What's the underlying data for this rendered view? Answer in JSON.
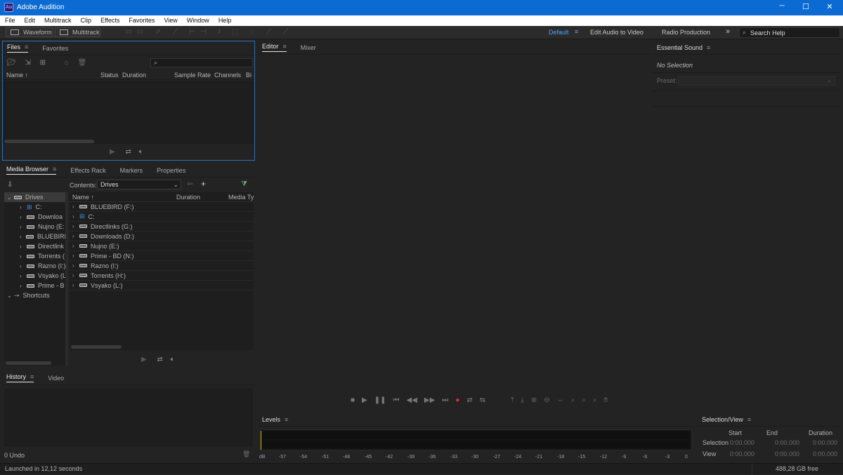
{
  "app": {
    "title": "Adobe Audition",
    "logo": "Au",
    "accent": "#0b6bd3"
  },
  "window_controls": {
    "minimize": "─",
    "maximize": "☐",
    "close": "✕"
  },
  "menu": [
    "File",
    "Edit",
    "Multitrack",
    "Clip",
    "Effects",
    "Favorites",
    "View",
    "Window",
    "Help"
  ],
  "toolbar": {
    "waveform_label": "Waveform",
    "multitrack_label": "Multitrack",
    "workspaces": [
      "Default",
      "Edit Audio to Video",
      "Radio Production"
    ],
    "active_workspace": "Default",
    "more": "»",
    "search_placeholder": "Search Help"
  },
  "files_panel": {
    "tabs": [
      "Files",
      "Favorites"
    ],
    "columns": [
      "Name",
      "Status",
      "Duration",
      "Sample Rate",
      "Channels",
      "Bi"
    ]
  },
  "media_browser": {
    "tabs": [
      "Media Browser",
      "Effects Rack",
      "Markers",
      "Properties"
    ],
    "contents_label": "Contents:",
    "contents_value": "Drives",
    "columns": [
      "Name",
      "Duration",
      "Media Ty"
    ],
    "tree": {
      "drives_label": "Drives",
      "drives": [
        "C:",
        "Downloa",
        "Nujno (E:",
        "BLUEBIRI",
        "Directlink",
        "Torrents (",
        "Razno (I:)",
        "Vsyako (L",
        "Prime - B"
      ],
      "shortcuts_label": "Shortcuts"
    },
    "list": [
      "BLUEBIRD (F:)",
      "C:",
      "Directlinks (G:)",
      "Downloads (D:)",
      "Nujno (E:)",
      "Prime - BD (N:)",
      "Razno (I:)",
      "Torrents (H:)",
      "Vsyako (L:)"
    ]
  },
  "history_panel": {
    "tabs": [
      "History",
      "Video"
    ],
    "undo_label": "0 Undo"
  },
  "editor_panel": {
    "tabs": [
      "Editor",
      "Mixer"
    ]
  },
  "essential_sound": {
    "title": "Essential Sound",
    "no_selection": "No Selection",
    "preset_label": "Preset:"
  },
  "levels": {
    "title": "Levels",
    "scale": [
      "dB",
      "-57",
      "-54",
      "-51",
      "-48",
      "-45",
      "-42",
      "-39",
      "-36",
      "-33",
      "-30",
      "-27",
      "-24",
      "-21",
      "-18",
      "-15",
      "-12",
      "-9",
      "-6",
      "-3",
      "0"
    ]
  },
  "selection_view": {
    "title": "Selection/View",
    "columns": [
      "Start",
      "End",
      "Duration"
    ],
    "rows": [
      {
        "label": "Selection",
        "start": "0:00.000",
        "end": "0:00.000",
        "duration": "0:00.000"
      },
      {
        "label": "View",
        "start": "0:00.000",
        "end": "0:00.000",
        "duration": "0:00.000"
      }
    ]
  },
  "status": {
    "launched": "Launched in 12,12 seconds",
    "free_space": "488,28 GB free"
  }
}
